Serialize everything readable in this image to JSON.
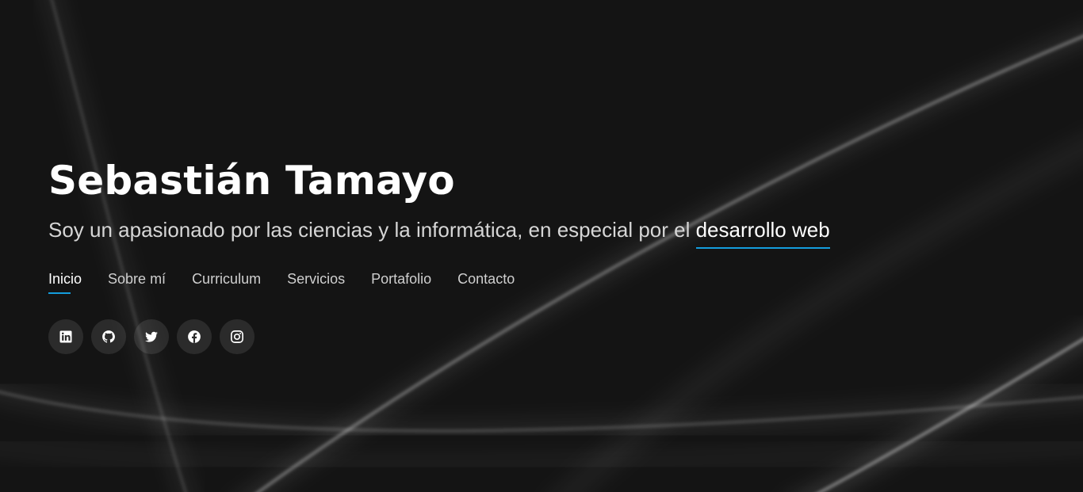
{
  "hero": {
    "name": "Sebastián Tamayo",
    "tagline_prefix": "Soy un apasionado por las ciencias y la informática, en especial por el ",
    "tagline_highlight": "desarrollo web"
  },
  "nav": {
    "items": [
      {
        "label": "Inicio",
        "active": true
      },
      {
        "label": "Sobre mí",
        "active": false
      },
      {
        "label": "Curriculum",
        "active": false
      },
      {
        "label": "Servicios",
        "active": false
      },
      {
        "label": "Portafolio",
        "active": false
      },
      {
        "label": "Contacto",
        "active": false
      }
    ]
  },
  "social": {
    "icons": [
      "linkedin-icon",
      "github-icon",
      "twitter-icon",
      "facebook-icon",
      "instagram-icon"
    ]
  },
  "colors": {
    "background": "#141414",
    "accent": "#149ddd",
    "text_primary": "#ffffff",
    "text_secondary": "#d6d6d6"
  }
}
